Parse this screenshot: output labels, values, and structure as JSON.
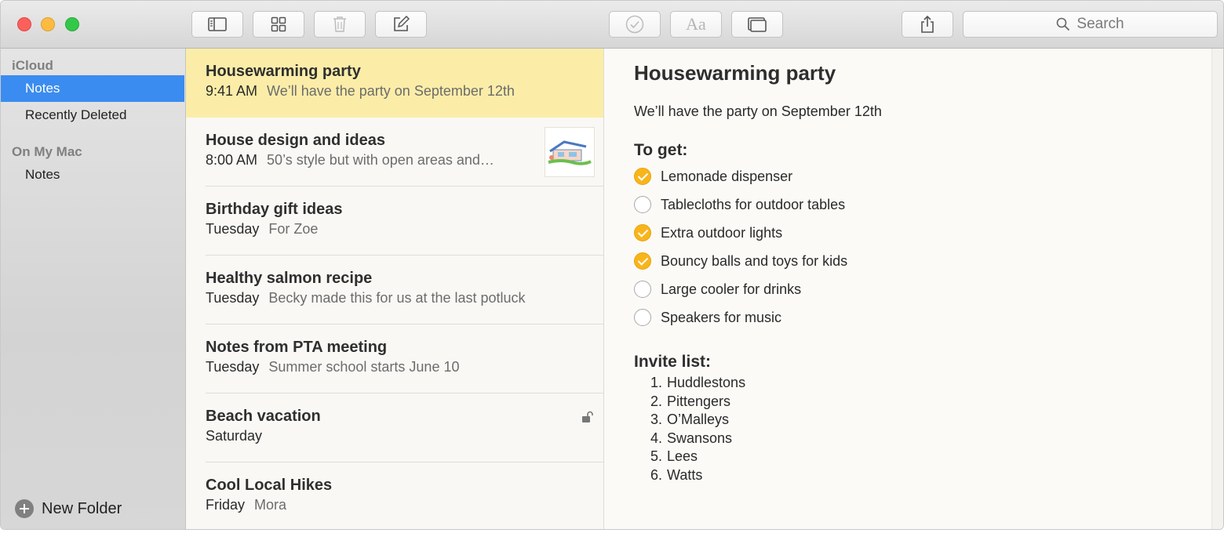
{
  "window": {
    "toolbar": {
      "buttons": [
        {
          "name": "sidebar-toggle-icon"
        },
        {
          "name": "attachments-browser-icon"
        },
        {
          "name": "trash-icon"
        },
        {
          "name": "compose-icon"
        },
        {
          "name": "checklist-icon"
        },
        {
          "name": "font-format-icon",
          "label": "Aa"
        },
        {
          "name": "table-icon"
        },
        {
          "name": "share-icon"
        }
      ],
      "search_placeholder": "Search"
    }
  },
  "sidebar": {
    "sections": [
      {
        "header": "iCloud",
        "items": [
          {
            "label": "Notes",
            "selected": true
          },
          {
            "label": "Recently Deleted",
            "selected": false
          }
        ]
      },
      {
        "header": "On My Mac",
        "items": [
          {
            "label": "Notes",
            "selected": false
          }
        ]
      }
    ],
    "new_folder_label": "New Folder"
  },
  "notes_list": [
    {
      "title": "Housewarming party",
      "date": "9:41 AM",
      "snippet": "We’ll have the party on September 12th",
      "selected": true
    },
    {
      "title": "House design and ideas",
      "date": "8:00 AM",
      "snippet": "50’s style but with open areas and…",
      "has_thumbnail": true
    },
    {
      "title": "Birthday gift ideas",
      "date": "Tuesday",
      "snippet": "For Zoe"
    },
    {
      "title": "Healthy salmon recipe",
      "date": "Tuesday",
      "snippet": "Becky made this for us at the last potluck"
    },
    {
      "title": "Notes from PTA meeting",
      "date": "Tuesday",
      "snippet": "Summer school starts June 10"
    },
    {
      "title": "Beach vacation",
      "date": "Saturday",
      "snippet": "",
      "locked": true
    },
    {
      "title": "Cool Local Hikes",
      "date": "Friday",
      "snippet": "Mora"
    }
  ],
  "editor": {
    "title": "Housewarming party",
    "body": "We’ll have the party on September 12th",
    "to_get_heading": "To get:",
    "checklist": [
      {
        "label": "Lemonade dispenser",
        "checked": true
      },
      {
        "label": "Tablecloths for outdoor tables",
        "checked": false
      },
      {
        "label": "Extra outdoor lights",
        "checked": true
      },
      {
        "label": "Bouncy balls and toys for kids",
        "checked": true
      },
      {
        "label": "Large cooler for drinks",
        "checked": false
      },
      {
        "label": "Speakers for music",
        "checked": false
      }
    ],
    "invite_heading": "Invite list:",
    "invite_list": [
      {
        "num": "1.",
        "name": "Huddlestons"
      },
      {
        "num": "2.",
        "name": "Pittengers"
      },
      {
        "num": "3.",
        "name": "O’Malleys"
      },
      {
        "num": "4.",
        "name": "Swansons"
      },
      {
        "num": "5.",
        "name": "Lees"
      },
      {
        "num": "6.",
        "name": "Watts"
      }
    ]
  },
  "colors": {
    "selection_blue": "#3b8cf0",
    "selected_note_yellow": "#fbeda8",
    "checkbox_checked": "#f8b51b"
  }
}
